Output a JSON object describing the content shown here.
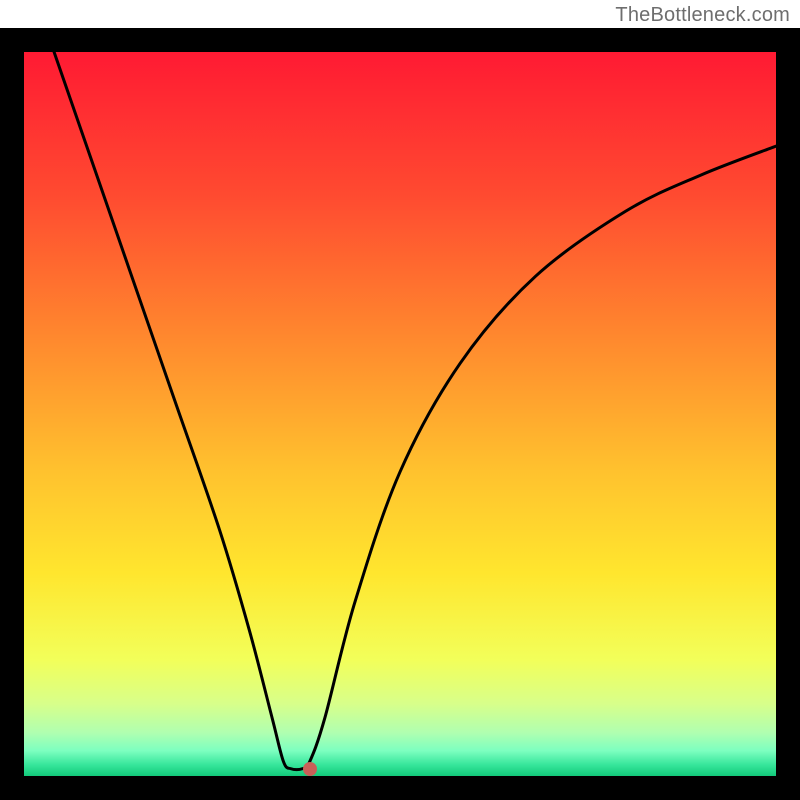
{
  "watermark": {
    "text": "TheBottleneck.com"
  },
  "colors": {
    "frame": "#000000",
    "curve": "#000000",
    "marker": "#c95f58",
    "gradient_stops": [
      {
        "offset": 0.0,
        "color": "#ff1a33"
      },
      {
        "offset": 0.2,
        "color": "#ff4b30"
      },
      {
        "offset": 0.4,
        "color": "#ff8a2e"
      },
      {
        "offset": 0.58,
        "color": "#ffc22e"
      },
      {
        "offset": 0.72,
        "color": "#ffe62e"
      },
      {
        "offset": 0.84,
        "color": "#f2ff5a"
      },
      {
        "offset": 0.9,
        "color": "#d8ff8a"
      },
      {
        "offset": 0.94,
        "color": "#b0ffb0"
      },
      {
        "offset": 0.965,
        "color": "#7dffc0"
      },
      {
        "offset": 0.985,
        "color": "#35e59a"
      },
      {
        "offset": 1.0,
        "color": "#12c97a"
      }
    ]
  },
  "chart_data": {
    "type": "line",
    "title": "",
    "xlabel": "",
    "ylabel": "",
    "xlim": [
      0,
      100
    ],
    "ylim": [
      0,
      100
    ],
    "grid": false,
    "series": [
      {
        "name": "bottleneck-curve",
        "points": [
          {
            "x": 4.0,
            "y": 100.0
          },
          {
            "x": 8.0,
            "y": 88.0
          },
          {
            "x": 14.0,
            "y": 70.0
          },
          {
            "x": 20.0,
            "y": 52.0
          },
          {
            "x": 26.0,
            "y": 34.0
          },
          {
            "x": 30.0,
            "y": 20.0
          },
          {
            "x": 33.0,
            "y": 8.0
          },
          {
            "x": 34.5,
            "y": 2.0
          },
          {
            "x": 35.5,
            "y": 1.0
          },
          {
            "x": 37.0,
            "y": 1.0
          },
          {
            "x": 38.0,
            "y": 2.0
          },
          {
            "x": 40.0,
            "y": 8.0
          },
          {
            "x": 44.0,
            "y": 24.0
          },
          {
            "x": 50.0,
            "y": 42.0
          },
          {
            "x": 58.0,
            "y": 57.0
          },
          {
            "x": 68.0,
            "y": 69.0
          },
          {
            "x": 80.0,
            "y": 78.0
          },
          {
            "x": 90.0,
            "y": 83.0
          },
          {
            "x": 100.0,
            "y": 87.0
          }
        ]
      }
    ],
    "marker": {
      "x": 38.0,
      "y": 1.0
    }
  }
}
